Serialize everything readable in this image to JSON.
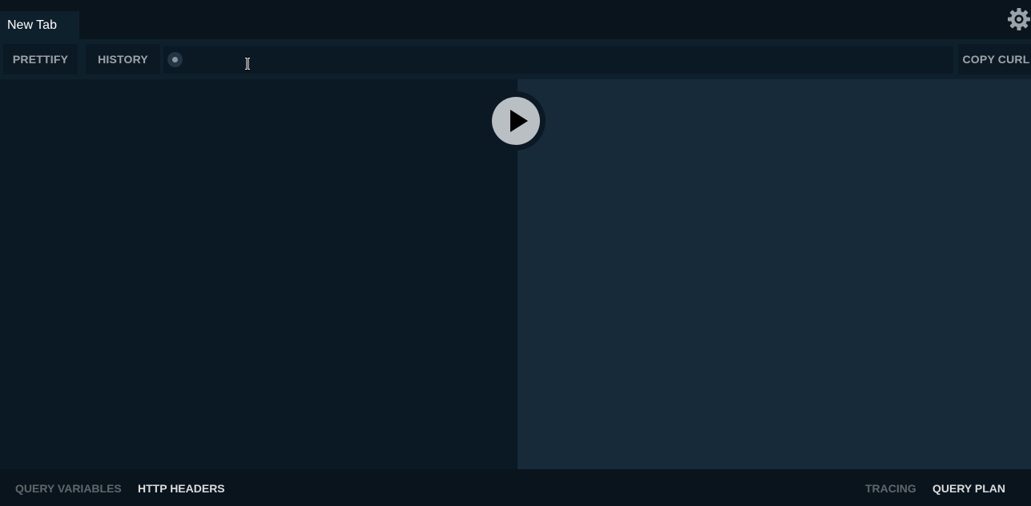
{
  "tabs": [
    {
      "label": "New Tab"
    }
  ],
  "settings": {
    "icon": "gear-icon"
  },
  "toolbar": {
    "prettify_label": "PRETTIFY",
    "history_label": "HISTORY",
    "copy_curl_label": "COPY CURL",
    "endpoint": {
      "value": "",
      "status_icon": "connection-status-icon"
    }
  },
  "editor": {
    "run_icon": "play-icon"
  },
  "bottom": {
    "query_variables_label": "QUERY VARIABLES",
    "http_headers_label": "HTTP HEADERS",
    "tracing_label": "TRACING",
    "query_plan_label": "QUERY PLAN"
  },
  "colors": {
    "editor_bg": "#0b1924",
    "result_bg": "#172a3a",
    "bar_bg": "#09141c",
    "button_bg": "#0b1924"
  }
}
